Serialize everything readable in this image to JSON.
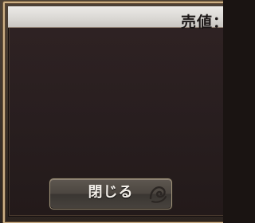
{
  "dialog": {
    "price_label": "売値：",
    "close_label": "閉じる"
  },
  "icons": {
    "button_ornament": "swirl-icon"
  },
  "colors": {
    "frame_gold": "#cdb187",
    "panel_dark": "#2a1f1c",
    "header_light": "#e3e1dd",
    "button_face": "#4c4640",
    "button_text": "#f3efe9"
  }
}
